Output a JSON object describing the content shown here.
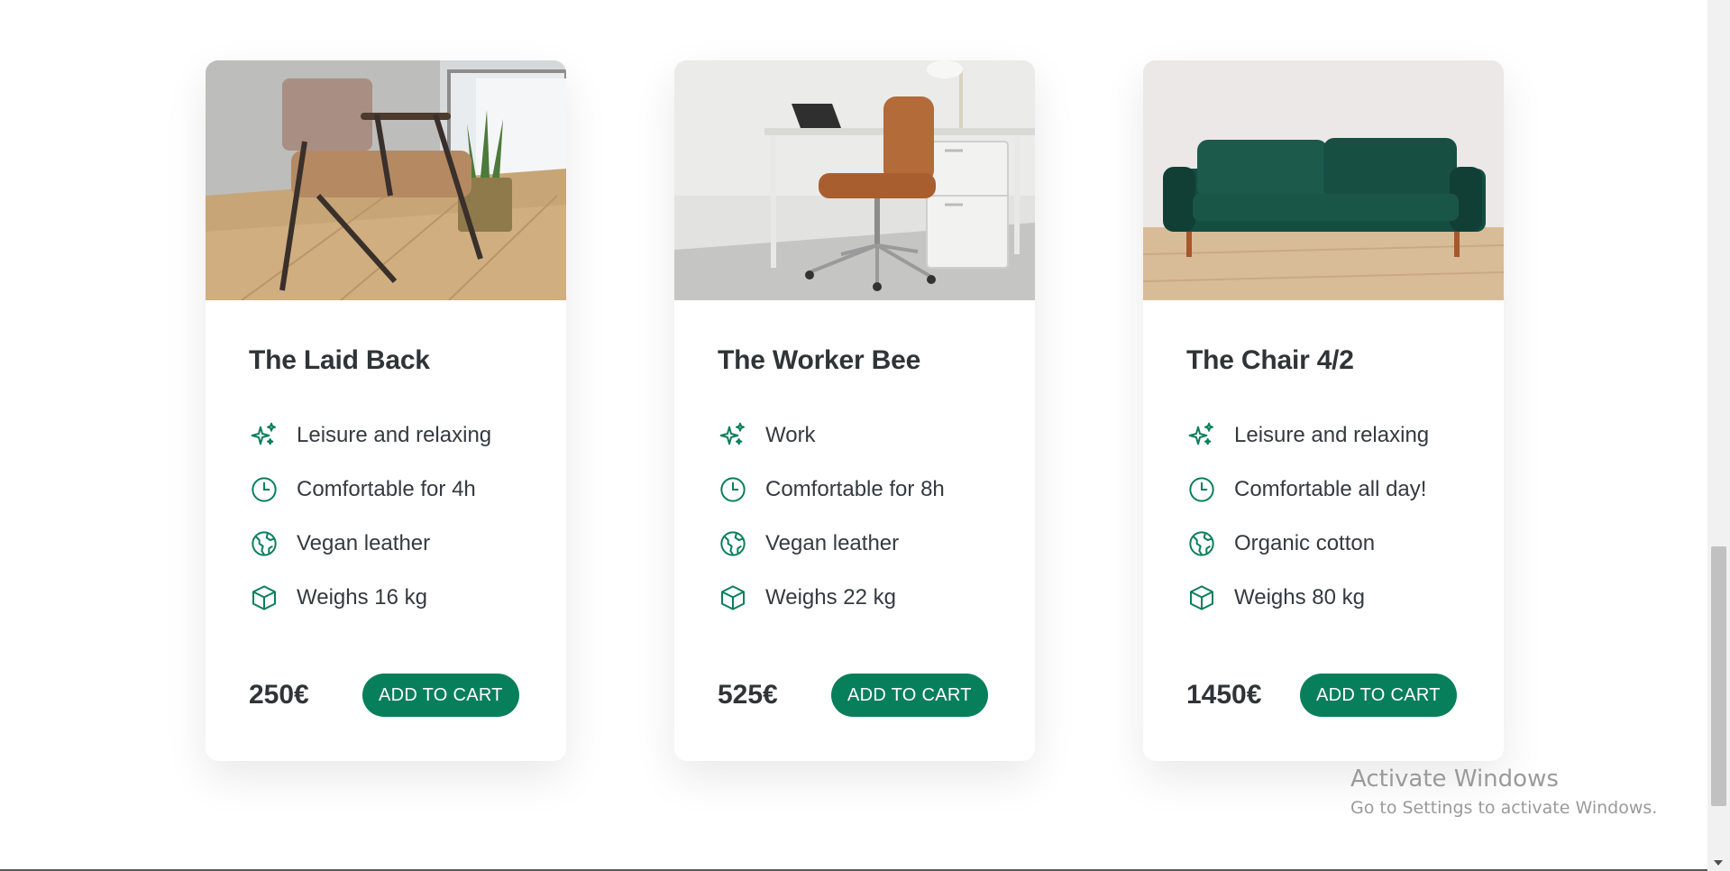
{
  "colors": {
    "accent": "#087f5b",
    "text": "#343a40",
    "heading": "#2f3437"
  },
  "products": [
    {
      "title": "The Laid Back",
      "image": "armchair-photo",
      "features": [
        {
          "icon": "sparkles-icon",
          "text": "Leisure and relaxing"
        },
        {
          "icon": "clock-icon",
          "text": "Comfortable for 4h"
        },
        {
          "icon": "globe-icon",
          "text": "Vegan leather"
        },
        {
          "icon": "box-icon",
          "text": "Weighs 16 kg"
        }
      ],
      "price": "250€",
      "button": "ADD TO CART"
    },
    {
      "title": "The Worker Bee",
      "image": "office-chair-photo",
      "features": [
        {
          "icon": "sparkles-icon",
          "text": "Work"
        },
        {
          "icon": "clock-icon",
          "text": "Comfortable for 8h"
        },
        {
          "icon": "globe-icon",
          "text": "Vegan leather"
        },
        {
          "icon": "box-icon",
          "text": "Weighs 22 kg"
        }
      ],
      "price": "525€",
      "button": "ADD TO CART"
    },
    {
      "title": "The Chair 4/2",
      "image": "green-sofa-photo",
      "features": [
        {
          "icon": "sparkles-icon",
          "text": "Leisure and relaxing"
        },
        {
          "icon": "clock-icon",
          "text": "Comfortable all day!"
        },
        {
          "icon": "globe-icon",
          "text": "Organic cotton"
        },
        {
          "icon": "box-icon",
          "text": "Weighs 80 kg"
        }
      ],
      "price": "1450€",
      "button": "ADD TO CART"
    }
  ],
  "watermark": {
    "title": "Activate Windows",
    "subtitle": "Go to Settings to activate Windows."
  }
}
